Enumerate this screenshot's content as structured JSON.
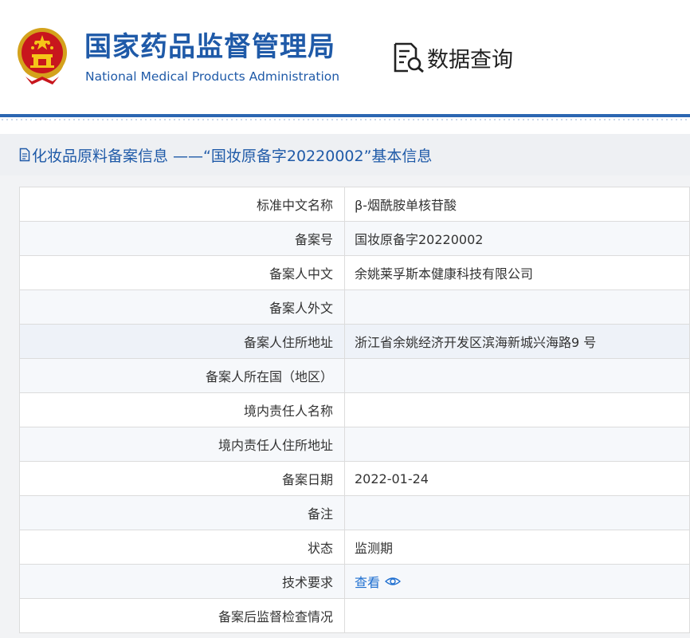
{
  "header": {
    "org_name_cn": "国家药品监督管理局",
    "org_name_en": "National Medical Products Administration",
    "query_label": "数据查询",
    "emblem_icon": "national-emblem-icon",
    "query_icon": "document-search-icon"
  },
  "panel": {
    "title": "化妆品原料备案信息 ——“国妆原备字20220002”基本信息",
    "title_icon": "document-icon"
  },
  "rows": [
    {
      "label": "标准中文名称",
      "value": "β-烟酰胺单核苷酸"
    },
    {
      "label": "备案号",
      "value": "国妆原备字20220002"
    },
    {
      "label": "备案人中文",
      "value": "余姚莱孚斯本健康科技有限公司"
    },
    {
      "label": "备案人外文",
      "value": ""
    },
    {
      "label": "备案人住所地址",
      "value": "浙江省余姚经济开发区滨海新城兴海路9 号"
    },
    {
      "label": "备案人所在国（地区）",
      "value": ""
    },
    {
      "label": "境内责任人名称",
      "value": ""
    },
    {
      "label": "境内责任人住所地址",
      "value": ""
    },
    {
      "label": "备案日期",
      "value": "2022-01-24"
    },
    {
      "label": "备注",
      "value": ""
    },
    {
      "label": "状态",
      "value": "监测期"
    },
    {
      "label": "技术要求",
      "link_text": "查看",
      "link_icon": "eye-icon"
    },
    {
      "label": "备案后监督检查情况",
      "value": ""
    }
  ],
  "colors": {
    "brand_blue": "#1f5aa8",
    "link_blue": "#1f6fd0",
    "divider_blue": "#2b66b2"
  }
}
